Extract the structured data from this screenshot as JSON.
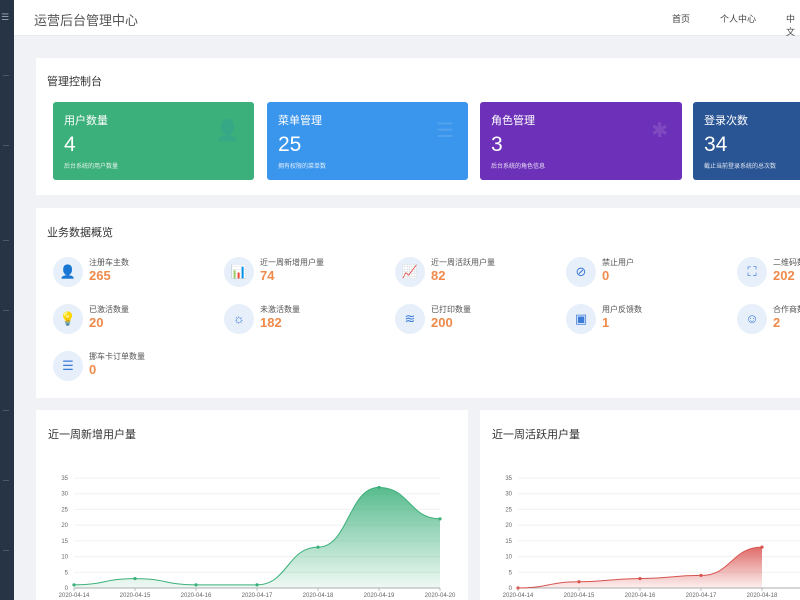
{
  "header": {
    "title": "运营后台管理中心",
    "nav": [
      "首页",
      "个人中心",
      "中文"
    ]
  },
  "dashboard": {
    "title": "管理控制台",
    "cards": [
      {
        "label": "用户数量",
        "value": "4",
        "desc": "后台系统的用户数量",
        "color": "#3bb07a"
      },
      {
        "label": "菜单管理",
        "value": "25",
        "desc": "拥有权限的菜单数",
        "color": "#3a95ec"
      },
      {
        "label": "角色管理",
        "value": "3",
        "desc": "后台系统的角色信息",
        "color": "#6d31b9"
      },
      {
        "label": "登录次数",
        "value": "34",
        "desc": "截止当前登录系统的总次数",
        "color": "#2a5595"
      }
    ]
  },
  "business": {
    "title": "业务数据概览",
    "items": [
      {
        "label": "注册车主数",
        "value": "265",
        "icon": "user-icon"
      },
      {
        "label": "近一周新增用户量",
        "value": "74",
        "icon": "bar-chart-icon"
      },
      {
        "label": "近一周活跃用户量",
        "value": "82",
        "icon": "trend-chart-icon"
      },
      {
        "label": "禁止用户",
        "value": "0",
        "icon": "ban-icon"
      },
      {
        "label": "二维码数",
        "value": "202",
        "icon": "scan-icon"
      },
      {
        "label": "已激活数量",
        "value": "20",
        "icon": "lightbulb-on-icon"
      },
      {
        "label": "未激活数量",
        "value": "182",
        "icon": "lightbulb-icon"
      },
      {
        "label": "已打印数量",
        "value": "200",
        "icon": "layers-icon"
      },
      {
        "label": "用户反馈数",
        "value": "1",
        "icon": "box-icon"
      },
      {
        "label": "合作商数",
        "value": "2",
        "icon": "smile-icon"
      },
      {
        "label": "挪车卡订单数量",
        "value": "0",
        "icon": "list-icon"
      }
    ]
  },
  "charts": {
    "new_users": {
      "title": "近一周新增用户量",
      "color": "#3bb07a"
    },
    "active_users": {
      "title": "近一周活跃用户量",
      "color": "#d9534f"
    }
  },
  "chart_data": [
    {
      "type": "area",
      "title": "近一周新增用户量",
      "x": [
        "2020-04-14",
        "2020-04-15",
        "2020-04-16",
        "2020-04-17",
        "2020-04-18",
        "2020-04-19",
        "2020-04-20"
      ],
      "y_ticks": [
        0,
        5,
        10,
        15,
        20,
        25,
        30,
        35
      ],
      "ylim": [
        0,
        35
      ],
      "series": [
        {
          "values": [
            1,
            3,
            1,
            1,
            13,
            32,
            22
          ]
        }
      ],
      "color": "#3bb07a",
      "grid": true
    },
    {
      "type": "area",
      "title": "近一周活跃用户量",
      "x": [
        "2020-04-14",
        "2020-04-15",
        "2020-04-16",
        "2020-04-17",
        "2020-04-18"
      ],
      "y_ticks": [
        0,
        5,
        10,
        15,
        20,
        25,
        30,
        35
      ],
      "ylim": [
        0,
        35
      ],
      "series": [
        {
          "values": [
            0,
            2,
            3,
            4,
            13
          ]
        }
      ],
      "color": "#d9534f",
      "grid": true
    }
  ]
}
